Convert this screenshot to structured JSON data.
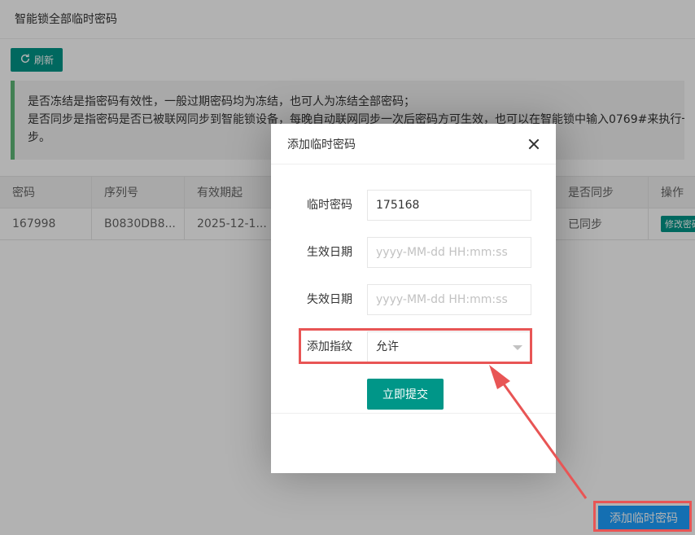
{
  "page": {
    "title": "智能锁全部临时密码",
    "refresh_label": "刷新",
    "notice_line1": "是否冻结是指密码有效性，一般过期密码均为冻结，也可人为冻结全部密码；",
    "notice_line2": "是否同步是指密码是否已被联网同步到智能锁设备，每晚自动联网同步一次后密码方可生效，也可以在智能锁中输入0769#来执行一次",
    "notice_line3": "步。",
    "add_button_label": "添加临时密码"
  },
  "table": {
    "headers": [
      "密码",
      "序列号",
      "有效期起",
      "",
      "是否同步",
      "操作"
    ],
    "rows": [
      [
        "167998",
        "B0830DB8...",
        "2025-12-1...",
        "",
        "已同步",
        "修改密码"
      ]
    ]
  },
  "modal": {
    "title": "添加临时密码",
    "fields": [
      {
        "label": "临时密码",
        "value": "175168",
        "placeholder": ""
      },
      {
        "label": "生效日期",
        "value": "",
        "placeholder": "yyyy-MM-dd HH:mm:ss"
      },
      {
        "label": "失效日期",
        "value": "",
        "placeholder": "yyyy-MM-dd HH:mm:ss"
      }
    ],
    "fingerprint_label": "添加指纹",
    "fingerprint_value": "允许",
    "submit_label": "立即提交"
  },
  "colors": {
    "primary": "#009688",
    "blue": "#1E9FFF",
    "highlight": "#e85555",
    "notice_border": "#5FB878"
  }
}
